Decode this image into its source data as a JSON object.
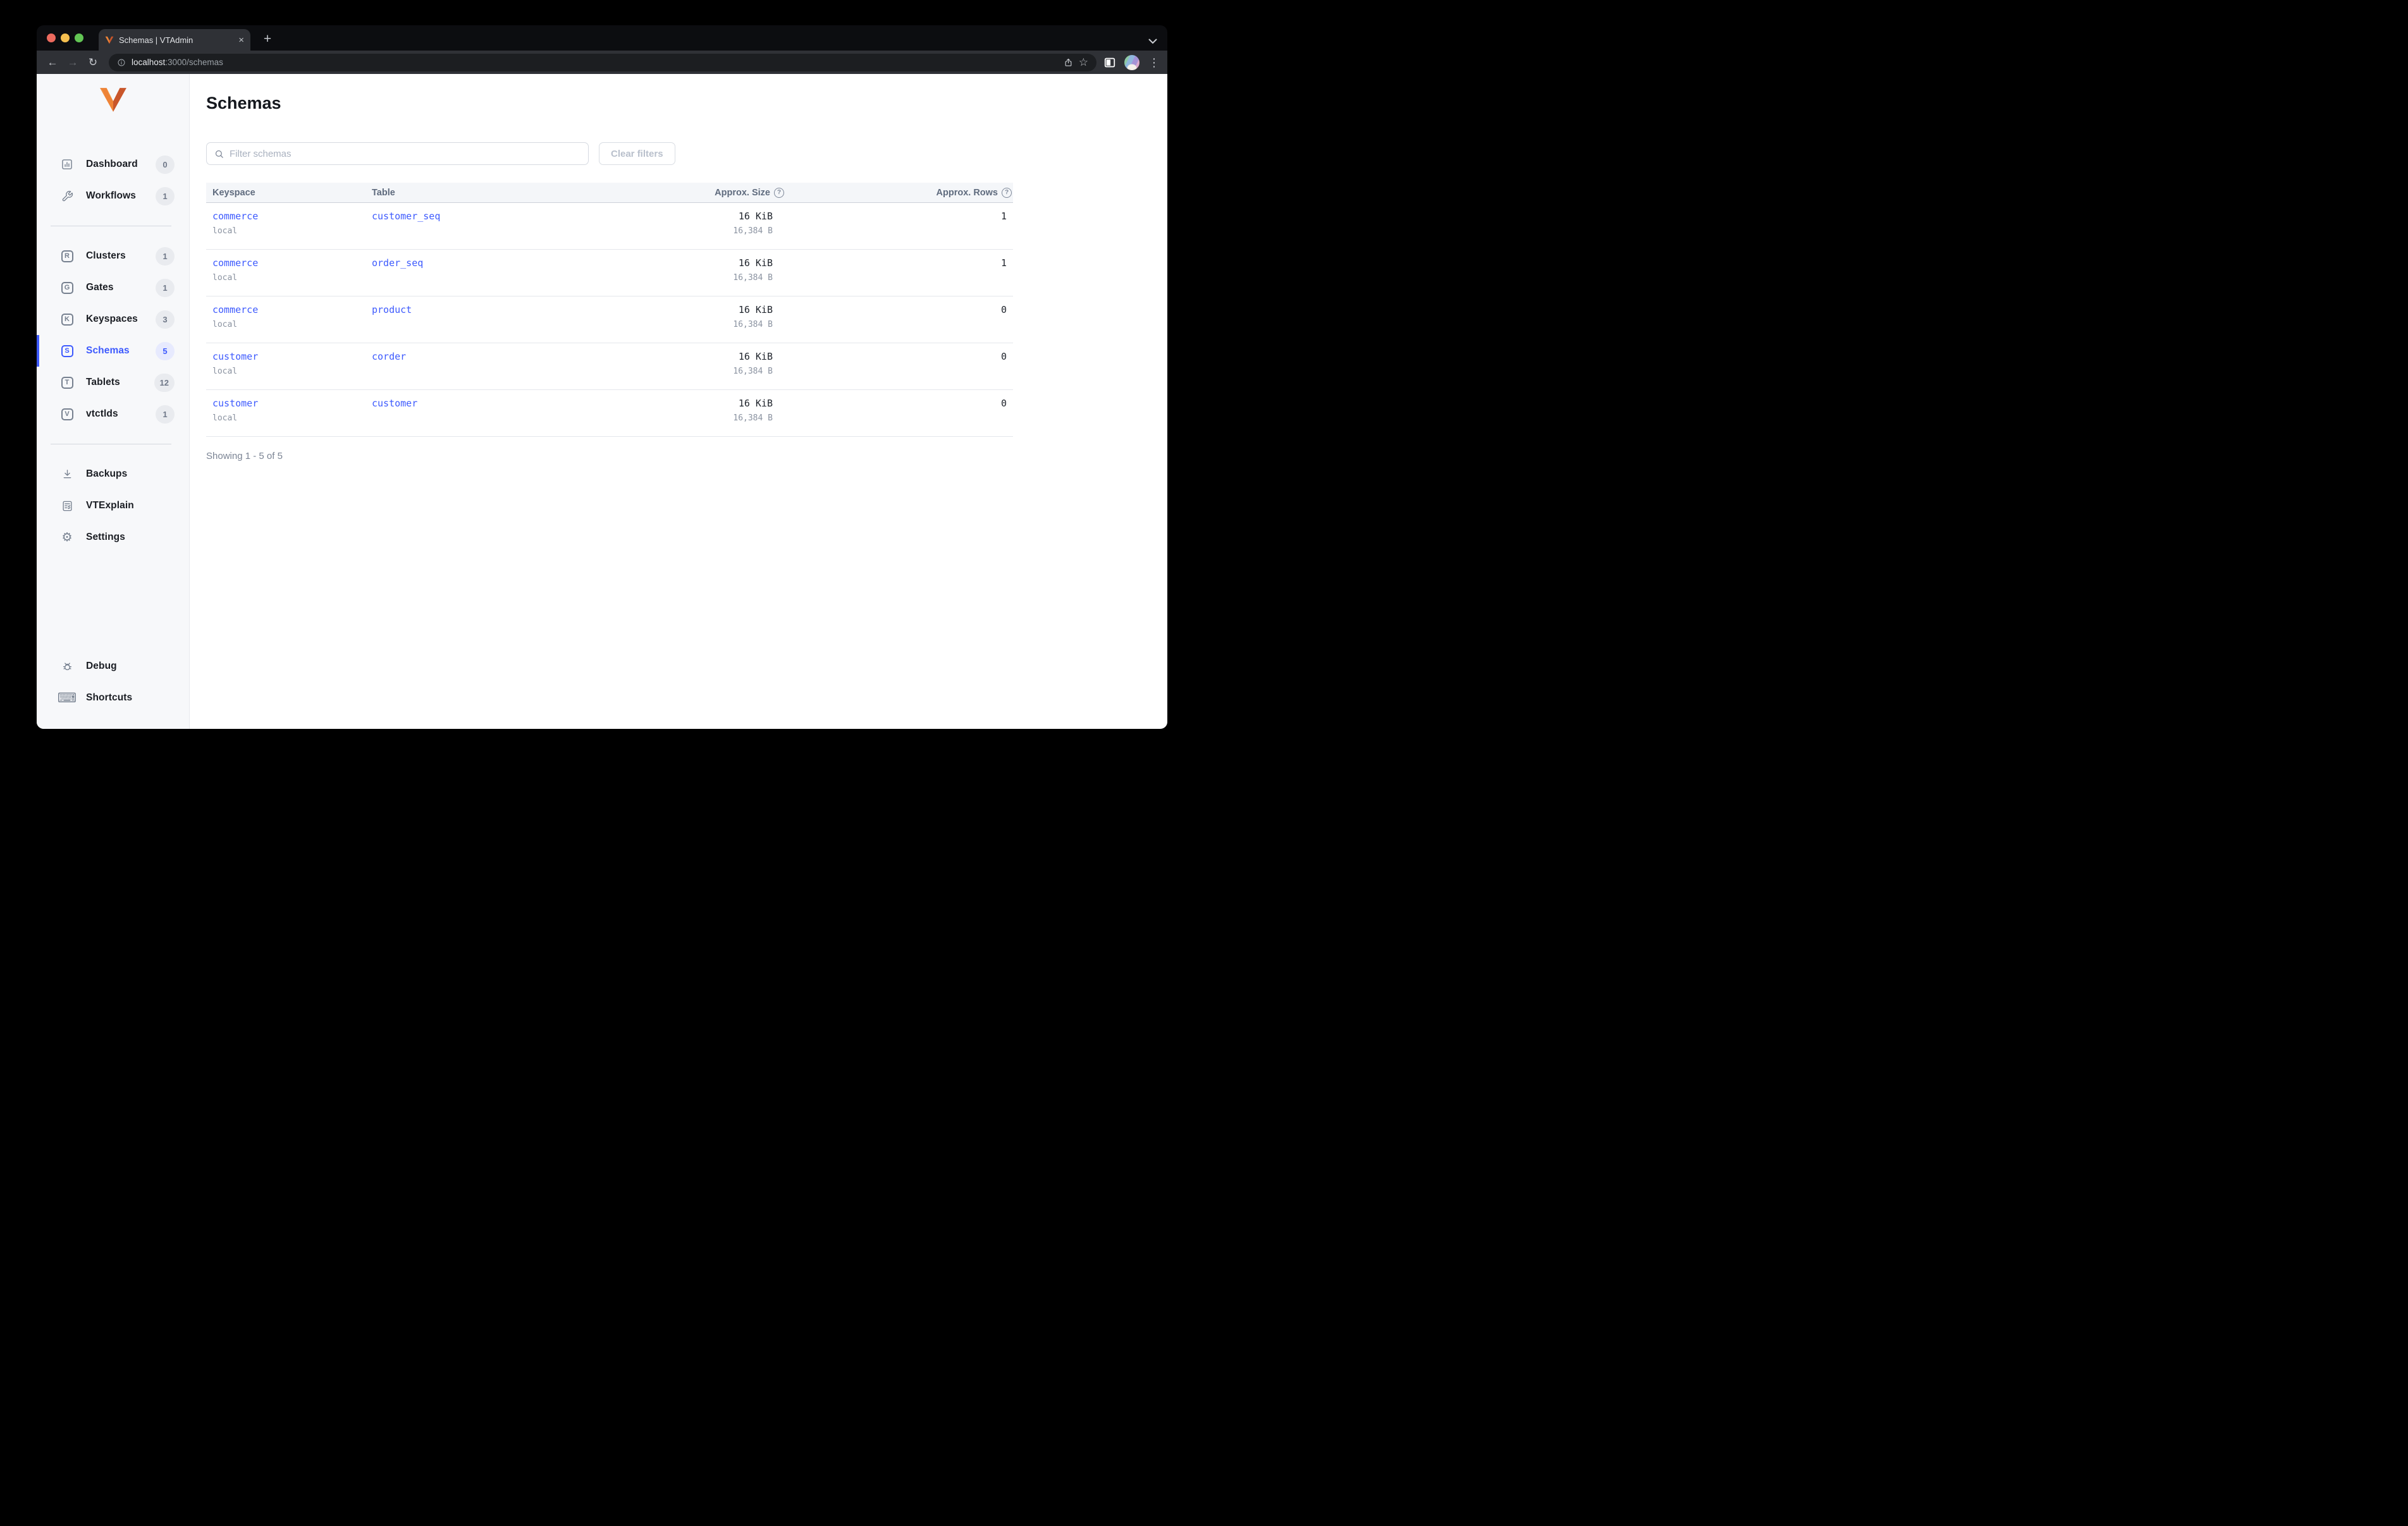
{
  "browser": {
    "tab_title": "Schemas | VTAdmin",
    "tab_close": "×",
    "new_tab": "+",
    "url_host": "localhost",
    "url_rest": ":3000/schemas",
    "menu_dots": "⋮",
    "star": "☆",
    "back": "←",
    "forward": "→",
    "reload": "↻"
  },
  "sidebar": {
    "items": [
      {
        "label": "Dashboard",
        "count": "0",
        "icon": "bar-chart-square"
      },
      {
        "label": "Workflows",
        "count": "1",
        "icon": "wrench"
      },
      {
        "label": "Clusters",
        "count": "1",
        "icon": "letter-R",
        "letter": "R"
      },
      {
        "label": "Gates",
        "count": "1",
        "icon": "letter-G",
        "letter": "G"
      },
      {
        "label": "Keyspaces",
        "count": "3",
        "icon": "letter-K",
        "letter": "K"
      },
      {
        "label": "Schemas",
        "count": "5",
        "icon": "letter-S",
        "letter": "S",
        "active": true
      },
      {
        "label": "Tablets",
        "count": "12",
        "icon": "letter-T",
        "letter": "T"
      },
      {
        "label": "vtctlds",
        "count": "1",
        "icon": "letter-V",
        "letter": "V"
      },
      {
        "label": "Backups",
        "icon": "download"
      },
      {
        "label": "VTExplain",
        "icon": "doc-check"
      },
      {
        "label": "Settings",
        "icon": "gear",
        "glyph": "⚙"
      },
      {
        "label": "Debug",
        "icon": "bug"
      },
      {
        "label": "Shortcuts",
        "icon": "keyboard",
        "glyph": "⌨"
      }
    ]
  },
  "main": {
    "title": "Schemas",
    "filter_placeholder": "Filter schemas",
    "clear_filters_label": "Clear filters",
    "table": {
      "columns": [
        {
          "label": "Keyspace"
        },
        {
          "label": "Table"
        },
        {
          "label": "Approx. Size",
          "help": "?"
        },
        {
          "label": "Approx. Rows",
          "help": "?"
        }
      ],
      "rows": [
        {
          "keyspace": "commerce",
          "cluster": "local",
          "table": "customer_seq",
          "size": "16 KiB",
          "size_bytes": "16,384 B",
          "rows": "1"
        },
        {
          "keyspace": "commerce",
          "cluster": "local",
          "table": "order_seq",
          "size": "16 KiB",
          "size_bytes": "16,384 B",
          "rows": "1"
        },
        {
          "keyspace": "commerce",
          "cluster": "local",
          "table": "product",
          "size": "16 KiB",
          "size_bytes": "16,384 B",
          "rows": "0"
        },
        {
          "keyspace": "customer",
          "cluster": "local",
          "table": "corder",
          "size": "16 KiB",
          "size_bytes": "16,384 B",
          "rows": "0"
        },
        {
          "keyspace": "customer",
          "cluster": "local",
          "table": "customer",
          "size": "16 KiB",
          "size_bytes": "16,384 B",
          "rows": "0"
        }
      ]
    },
    "showing": "Showing 1 - 5 of 5"
  },
  "colors": {
    "accent_blue": "#3d5afe",
    "logo_orange_light": "#f5a24b",
    "logo_orange": "#ee8336",
    "logo_orange_dark": "#c9562a",
    "traffic_red": "#ec6a5e",
    "traffic_yellow": "#f5bf4f",
    "traffic_green": "#62c554"
  }
}
